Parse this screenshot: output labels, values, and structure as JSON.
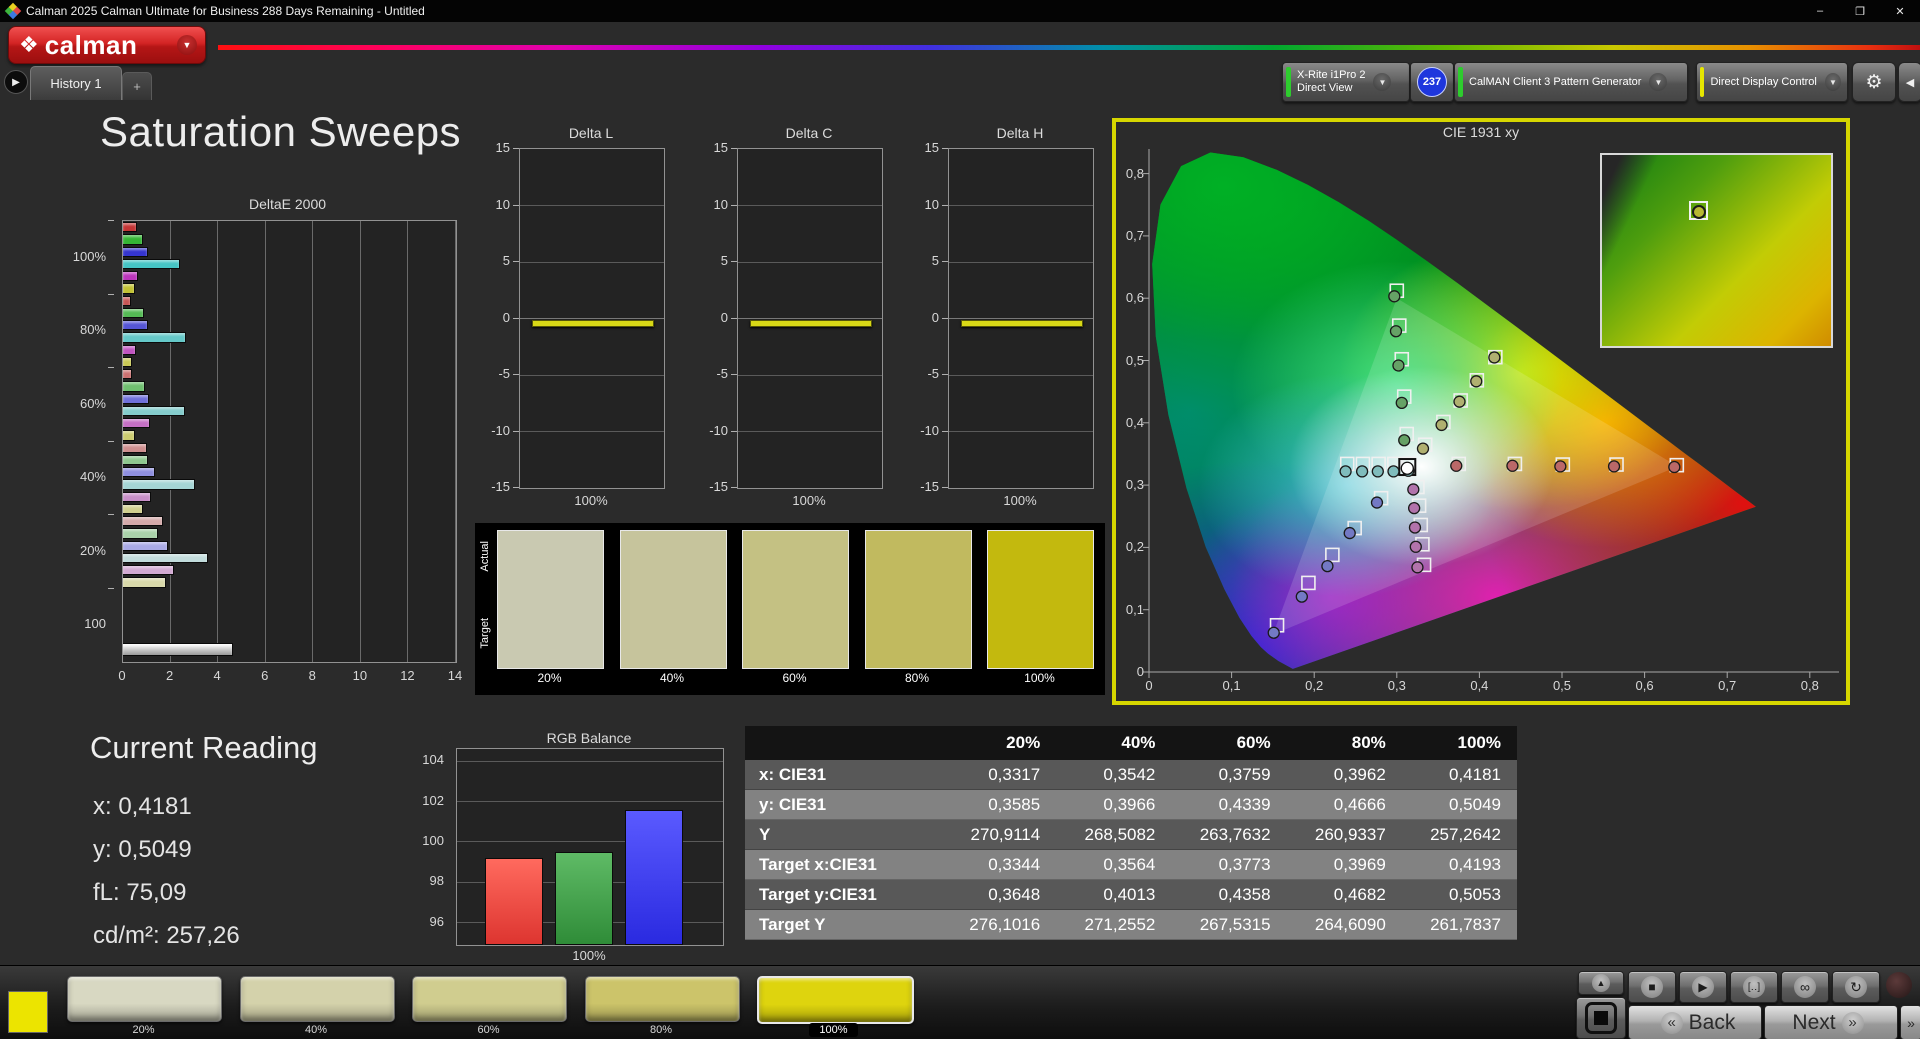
{
  "window": {
    "title": "Calman 2025 Calman Ultimate for Business 288 Days Remaining  - Untitled",
    "minimize": "–",
    "restore": "❐",
    "close": "✕"
  },
  "header": {
    "logo_label": "calman",
    "probe_line1": "X-Rite i1Pro 2",
    "probe_line2": "Direct View",
    "badge_count": "237",
    "pattern_generator_label": "CalMAN Client 3 Pattern Generator",
    "display_control_label": "Direct Display Control"
  },
  "tabs": {
    "history_label": "History 1",
    "add_label": "+"
  },
  "page_title": "Saturation Sweeps",
  "current_reading": {
    "title": "Current Reading",
    "lines": [
      "x: 0,4181",
      "y: 0,5049",
      "fL: 75,09",
      "cd/m²: 257,26"
    ]
  },
  "table": {
    "col_headers": [
      "",
      "20%",
      "40%",
      "60%",
      "80%",
      "100%"
    ],
    "rows": [
      {
        "label": "x: CIE31",
        "values": [
          "0,3317",
          "0,3542",
          "0,3759",
          "0,3962",
          "0,4181"
        ]
      },
      {
        "label": "y: CIE31",
        "values": [
          "0,3585",
          "0,3966",
          "0,4339",
          "0,4666",
          "0,5049"
        ]
      },
      {
        "label": "Y",
        "values": [
          "270,9114",
          "268,5082",
          "263,7632",
          "260,9337",
          "257,2642"
        ]
      },
      {
        "label": "Target x:CIE31",
        "values": [
          "0,3344",
          "0,3564",
          "0,3773",
          "0,3969",
          "0,4193"
        ]
      },
      {
        "label": "Target y:CIE31",
        "values": [
          "0,3648",
          "0,4013",
          "0,4358",
          "0,4682",
          "0,5053"
        ]
      },
      {
        "label": "Target Y",
        "values": [
          "276,1016",
          "271,2552",
          "267,5315",
          "264,6090",
          "261,7837"
        ]
      }
    ]
  },
  "bottombar": {
    "swatches": [
      {
        "label": "20%",
        "color": "#d8d8c2",
        "selected": false
      },
      {
        "label": "40%",
        "color": "#d4d2ab",
        "selected": false
      },
      {
        "label": "60%",
        "color": "#d0cd8f",
        "selected": false
      },
      {
        "label": "80%",
        "color": "#ccc46a",
        "selected": false
      },
      {
        "label": "100%",
        "color": "#ded40e",
        "selected": true
      }
    ],
    "back_label": "Back",
    "next_label": "Next"
  },
  "chart_data": {
    "deltae_2000": {
      "type": "bar",
      "title": "DeltaE 2000",
      "xlim": [
        0,
        14
      ],
      "x_ticks": [
        0,
        2,
        4,
        6,
        8,
        10,
        12,
        14
      ],
      "groups": [
        {
          "label": "100%",
          "bars": [
            {
              "color": "#c43535",
              "value": 0.55
            },
            {
              "color": "#35b535",
              "value": 0.8
            },
            {
              "color": "#3535cf",
              "value": 1.0
            },
            {
              "color": "#45c4c4",
              "value": 2.35
            },
            {
              "color": "#bc35bc",
              "value": 0.6
            },
            {
              "color": "#c2c235",
              "value": 0.45
            }
          ]
        },
        {
          "label": "80%",
          "bars": [
            {
              "color": "#c75555",
              "value": 0.3
            },
            {
              "color": "#55bb55",
              "value": 0.85
            },
            {
              "color": "#5555d5",
              "value": 1.0
            },
            {
              "color": "#65c8c8",
              "value": 2.6
            },
            {
              "color": "#c055c0",
              "value": 0.5
            },
            {
              "color": "#c8c855",
              "value": 0.35
            }
          ]
        },
        {
          "label": "60%",
          "bars": [
            {
              "color": "#cb7070",
              "value": 0.35
            },
            {
              "color": "#70c070",
              "value": 0.9
            },
            {
              "color": "#7070da",
              "value": 1.05
            },
            {
              "color": "#85cccc",
              "value": 2.55
            },
            {
              "color": "#c470c4",
              "value": 1.1
            },
            {
              "color": "#cccc70",
              "value": 0.45
            }
          ]
        },
        {
          "label": "40%",
          "bars": [
            {
              "color": "#cf8f8f",
              "value": 0.95
            },
            {
              "color": "#8fc88f",
              "value": 1.0
            },
            {
              "color": "#8f8fdf",
              "value": 1.3
            },
            {
              "color": "#a5d4d4",
              "value": 3.0
            },
            {
              "color": "#c88fc8",
              "value": 1.15
            },
            {
              "color": "#d0d08f",
              "value": 0.8
            }
          ]
        },
        {
          "label": "20%",
          "bars": [
            {
              "color": "#d4aaaa",
              "value": 1.65
            },
            {
              "color": "#aad2aa",
              "value": 1.45
            },
            {
              "color": "#aaaae5",
              "value": 1.85
            },
            {
              "color": "#c2dcdc",
              "value": 3.55
            },
            {
              "color": "#d2aad2",
              "value": 2.1
            },
            {
              "color": "#d8d8aa",
              "value": 1.75
            }
          ]
        },
        {
          "label": "100",
          "bars": [
            {
              "color": "#f0f0f0",
              "value": 4.6
            }
          ]
        }
      ]
    },
    "delta_l": {
      "type": "line",
      "title": "Delta L",
      "ylim": [
        -15,
        15
      ],
      "y_ticks": [
        15,
        10,
        5,
        0,
        -5,
        -10,
        -15
      ],
      "x_label": "100%",
      "value": -0.4
    },
    "delta_c": {
      "type": "line",
      "title": "Delta C",
      "ylim": [
        -15,
        15
      ],
      "y_ticks": [
        15,
        10,
        5,
        0,
        -5,
        -10,
        -15
      ],
      "x_label": "100%",
      "value": -0.4
    },
    "delta_h": {
      "type": "line",
      "title": "Delta H",
      "ylim": [
        -15,
        15
      ],
      "y_ticks": [
        15,
        10,
        5,
        0,
        -5,
        -10,
        -15
      ],
      "x_label": "100%",
      "value": -0.4
    },
    "swatch_strip": {
      "row_labels": [
        "Actual",
        "Target"
      ],
      "items": [
        {
          "label": "20%",
          "color": "#c9c9b1"
        },
        {
          "label": "40%",
          "color": "#c6c49c"
        },
        {
          "label": "60%",
          "color": "#c4c183"
        },
        {
          "label": "80%",
          "color": "#c1ba5f"
        },
        {
          "label": "100%",
          "color": "#c3b90e"
        }
      ]
    },
    "cie": {
      "type": "scatter",
      "title": "CIE 1931 xy",
      "x_ticks": [
        "0",
        "0,1",
        "0,2",
        "0,3",
        "0,4",
        "0,5",
        "0,6",
        "0,7",
        "0,8"
      ],
      "y_ticks": [
        "0",
        "0,1",
        "0,2",
        "0,3",
        "0,4",
        "0,5",
        "0,6",
        "0,7",
        "0,8"
      ],
      "xlim": [
        0,
        0.835
      ],
      "ylim": [
        0,
        0.84
      ],
      "srgb_triangle": [
        [
          0.64,
          0.33
        ],
        [
          0.3,
          0.6
        ],
        [
          0.15,
          0.06
        ]
      ],
      "white_point": {
        "target": [
          0.3127,
          0.329
        ],
        "measured": [
          0.3127,
          0.327
        ]
      },
      "sweeps": [
        {
          "name": "red",
          "color": "#bb6868",
          "targets": [
            [
              0.375,
              0.334
            ],
            [
              0.443,
              0.334
            ],
            [
              0.501,
              0.333
            ],
            [
              0.566,
              0.333
            ],
            [
              0.639,
              0.332
            ]
          ],
          "measured": [
            [
              0.372,
              0.331
            ],
            [
              0.44,
              0.331
            ],
            [
              0.498,
              0.33
            ],
            [
              0.563,
              0.33
            ],
            [
              0.636,
              0.329
            ]
          ]
        },
        {
          "name": "green",
          "color": "#66a266",
          "targets": [
            [
              0.312,
              0.382
            ],
            [
              0.309,
              0.442
            ],
            [
              0.306,
              0.502
            ],
            [
              0.303,
              0.556
            ],
            [
              0.3,
              0.612
            ]
          ],
          "measured": [
            [
              0.309,
              0.372
            ],
            [
              0.306,
              0.432
            ],
            [
              0.302,
              0.492
            ],
            [
              0.299,
              0.547
            ],
            [
              0.297,
              0.603
            ]
          ]
        },
        {
          "name": "blue",
          "color": "#7379c4",
          "targets": [
            [
              0.281,
              0.279
            ],
            [
              0.249,
              0.231
            ],
            [
              0.222,
              0.188
            ],
            [
              0.193,
              0.143
            ],
            [
              0.155,
              0.075
            ]
          ],
          "measured": [
            [
              0.276,
              0.272
            ],
            [
              0.243,
              0.223
            ],
            [
              0.216,
              0.17
            ],
            [
              0.185,
              0.121
            ],
            [
              0.151,
              0.063
            ]
          ]
        },
        {
          "name": "cyan",
          "color": "#7fbcbc",
          "targets": [
            [
              0.24,
              0.334
            ],
            [
              0.259,
              0.334
            ],
            [
              0.278,
              0.334
            ],
            [
              0.297,
              0.334
            ],
            [
              0.315,
              0.334
            ]
          ],
          "measured": [
            [
              0.238,
              0.322
            ],
            [
              0.258,
              0.322
            ],
            [
              0.277,
              0.322
            ],
            [
              0.296,
              0.322
            ],
            [
              0.314,
              0.323
            ]
          ]
        },
        {
          "name": "magenta",
          "color": "#b273ab",
          "targets": [
            [
              0.325,
              0.297
            ],
            [
              0.327,
              0.267
            ],
            [
              0.329,
              0.236
            ],
            [
              0.331,
              0.205
            ],
            [
              0.333,
              0.172
            ]
          ],
          "measured": [
            [
              0.32,
              0.293
            ],
            [
              0.321,
              0.263
            ],
            [
              0.322,
              0.232
            ],
            [
              0.323,
              0.201
            ],
            [
              0.325,
              0.168
            ]
          ]
        },
        {
          "name": "yellow",
          "color": "#b0b070",
          "targets": [
            [
              0.3344,
              0.3648
            ],
            [
              0.3564,
              0.4013
            ],
            [
              0.3773,
              0.4358
            ],
            [
              0.3969,
              0.4682
            ],
            [
              0.4193,
              0.5053
            ]
          ],
          "measured": [
            [
              0.3317,
              0.3585
            ],
            [
              0.3542,
              0.3966
            ],
            [
              0.3759,
              0.4339
            ],
            [
              0.3962,
              0.4666
            ],
            [
              0.4181,
              0.5049
            ]
          ]
        }
      ]
    },
    "rgb_balance": {
      "type": "bar",
      "title": "RGB Balance",
      "y_ticks": [
        104,
        102,
        100,
        98,
        96
      ],
      "ylim": [
        94.9,
        104.6
      ],
      "x_label": "100%",
      "bars": [
        {
          "name": "red",
          "value": 99.2,
          "color_top": "#ff6a5e",
          "color_bottom": "#dd3530"
        },
        {
          "name": "green",
          "value": 99.5,
          "color_top": "#5fbb66",
          "color_bottom": "#2f8c38"
        },
        {
          "name": "blue",
          "value": 101.6,
          "color_top": "#5a5aff",
          "color_bottom": "#2a2ae0"
        }
      ]
    }
  }
}
